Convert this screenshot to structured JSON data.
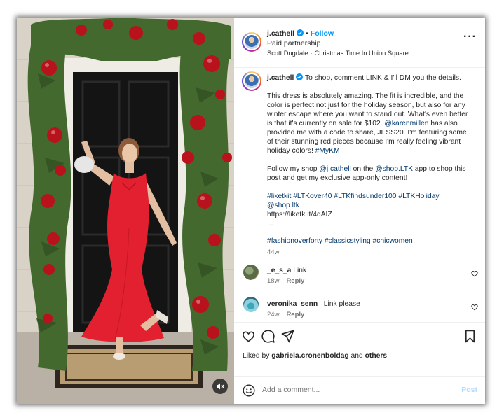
{
  "post": {
    "username": "j.cathell",
    "follow_label": "Follow",
    "paid_label": "Paid partnership",
    "audio_artist": "Scott Dugdale",
    "audio_title": "Christmas Time In Union Square",
    "more_label": "···"
  },
  "caption": {
    "username": "j.cathell",
    "line1": "To shop, comment LINK & I'll DM you the details.",
    "para1_a": "This dress is absolutely amazing. The fit is incredible, and the color is perfect not just for the holiday season, but also for any winter escape where you want to stand out. What's even better is that it's currently on sale for $102.",
    "mention_karen": "@karenmillen",
    "para1_b": "has also provided me with a code to share, JESS20. I'm featuring some of their stunning red pieces because I'm really feeling vibrant holiday colors!",
    "tag_mykm": "#MyKM",
    "para2_a": "Follow my shop",
    "mention_self": "@j.cathell",
    "para2_b": "on the",
    "mention_ltk": "@shop.LTK",
    "para2_c": "app to shop this post and get my exclusive app-only content!",
    "tags_line": "#liketkit #LTKover40 #LTKfindsunder100 #LTKHoliday",
    "tag_shop": "@shop.ltk",
    "url": "https://liketk.it/4qAIZ",
    "ellipsis": "...",
    "tags_bottom": "#fashionoverforty #classicstyling #chicwomen",
    "age": "44w"
  },
  "comments": [
    {
      "username": "_e_s_a",
      "text": "Link",
      "age": "18w",
      "reply": "Reply"
    },
    {
      "username": "veronika_senn_",
      "text": "Link please",
      "age": "24w",
      "reply": "Reply"
    }
  ],
  "actions": {
    "liked_by_prefix": "Liked by",
    "liked_by_user": "gabriela.cronenboldag",
    "liked_by_and": "and",
    "liked_by_others": "others"
  },
  "composer": {
    "placeholder": "Add a comment...",
    "post_label": "Post"
  },
  "icons": {
    "verified": "verified-badge-icon",
    "heart": "heart-icon",
    "comment": "comment-icon",
    "share": "share-icon",
    "save": "bookmark-icon",
    "emoji": "emoji-icon",
    "mute": "muted-speaker-icon"
  },
  "colors": {
    "accent": "#0095f6",
    "link": "#00376b",
    "muted": "#737373",
    "dress": "#e2202f"
  }
}
